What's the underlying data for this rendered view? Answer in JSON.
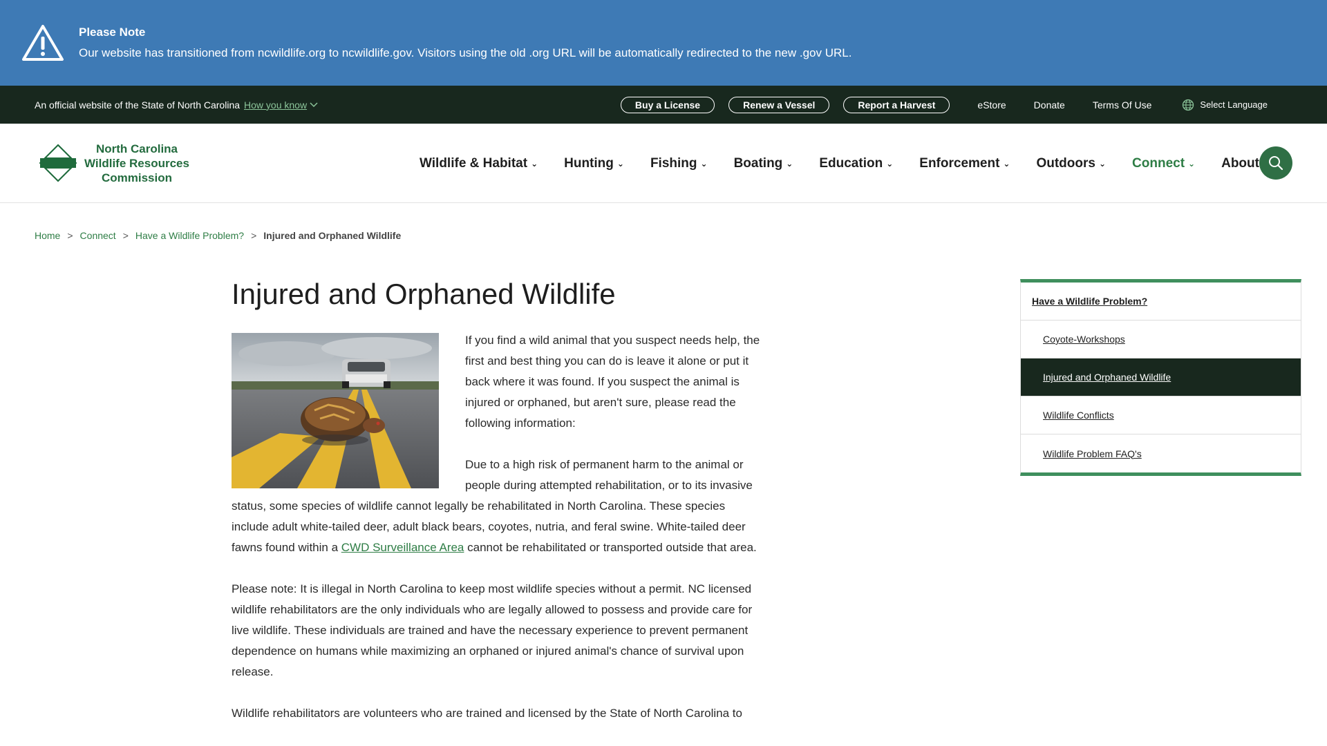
{
  "alert": {
    "title": "Please Note",
    "body": "Our website has transitioned from ncwildlife.org to ncwildlife.gov. Visitors using the old .org URL will be automatically redirected to the new .gov URL.",
    "icon": "warning-triangle-icon",
    "color": "#3e7ab5"
  },
  "utility": {
    "official_text": "An official website of the State of North Carolina",
    "how_you_know": "How you know",
    "buttons": [
      "Buy a License",
      "Renew a Vessel",
      "Report a Harvest"
    ],
    "links": [
      "eStore",
      "Donate",
      "Terms Of Use"
    ],
    "language": "Select Language",
    "color": "#18281e"
  },
  "header": {
    "logo_line1": "North Carolina",
    "logo_line2": "Wildlife Resources",
    "logo_line3": "Commission",
    "nav": [
      "Wildlife & Habitat",
      "Hunting",
      "Fishing",
      "Boating",
      "Education",
      "Enforcement",
      "Outdoors",
      "Connect",
      "About"
    ],
    "active_nav": "Connect",
    "accent": "#2e7d45"
  },
  "breadcrumb": {
    "items": [
      "Home",
      "Connect",
      "Have a Wildlife Problem?"
    ],
    "current": "Injured and Orphaned Wildlife"
  },
  "main": {
    "title": "Injured and Orphaned Wildlife",
    "p1": "If you find a wild animal that you suspect needs help, the first and best thing you can do is leave it alone or put it back where it was found. If you suspect the animal is injured or orphaned, but aren't sure, please read the following information:",
    "p2_before": "Due to a high risk of permanent harm to the animal or people during attempted rehabilitation, or to its invasive status, some species of wildlife cannot legally be rehabilitated in North Carolina. These species include adult white-tailed deer, adult black bears, coyotes, nutria, and feral swine. White-tailed deer fawns found within a ",
    "p2_link": "CWD Surveillance Area",
    "p2_after": " cannot be rehabilitated or transported outside that area.",
    "p3": "Please note:  It is illegal in North Carolina to keep most wildlife species without a permit. NC licensed wildlife rehabilitators are the only individuals who are legally allowed to possess and provide care for live wildlife. These individuals are trained and have the necessary experience to prevent permanent dependence on humans while maximizing an orphaned or injured animal's chance of survival upon release.",
    "p4": "Wildlife rehabilitators are volunteers who are trained and licensed by the State of North Carolina to"
  },
  "sidenav": {
    "heading": "Have a Wildlife Problem?",
    "items": [
      "Coyote-Workshops",
      "Injured and Orphaned Wildlife",
      "Wildlife Conflicts",
      "Wildlife Problem FAQ's"
    ],
    "active": "Injured and Orphaned Wildlife"
  }
}
